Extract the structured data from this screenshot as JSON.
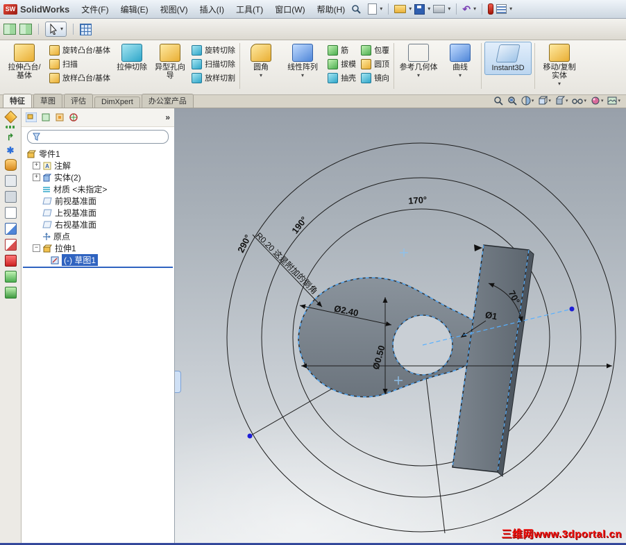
{
  "titlebar": {
    "app": "SolidWorks",
    "logo_mark": "SW",
    "menus": [
      "文件(F)",
      "编辑(E)",
      "视图(V)",
      "插入(I)",
      "工具(T)",
      "窗口(W)",
      "帮助(H)"
    ]
  },
  "ribbon": {
    "extrude_boss": "拉伸凸台/基体",
    "revolve_boss": "旋转凸台/基体",
    "sweep": "扫描",
    "loft_boss": "放样凸台/基体",
    "extrude_cut": "拉伸切除",
    "hole_wizard": "异型孔向导",
    "revolve_cut": "旋转切除",
    "sweep_cut": "扫描切除",
    "loft_cut": "放样切割",
    "fillet": "圆角",
    "linear_pattern": "线性阵列",
    "rib": "筋",
    "draft": "拔模",
    "shell": "抽壳",
    "wrap": "包覆",
    "dome": "圆顶",
    "mirror": "镜向",
    "ref_geometry": "参考几何体",
    "curves": "曲线",
    "instant3d": "Instant3D",
    "move_copy": "移动/复制实体"
  },
  "tabs": [
    "特征",
    "草图",
    "评估",
    "DimXpert",
    "办公室产品"
  ],
  "tree": {
    "root": "零件1",
    "chev": "»",
    "items": [
      "注解",
      "实体(2)",
      "材质 <未指定>",
      "前视基准面",
      "上视基准面",
      "右视基准面",
      "原点",
      "拉伸1",
      "(-) 草图1"
    ]
  },
  "viewport": {
    "dims": {
      "a170": "170°",
      "a190": "190°",
      "a290": "290°",
      "r020": "R0.20 这是附加的倒角",
      "d240": "Ø2.40",
      "d050": "Ø0.50",
      "d1": "Ø1",
      "a70": "70°"
    },
    "watermark": "三维网www.3dportal.cn"
  }
}
